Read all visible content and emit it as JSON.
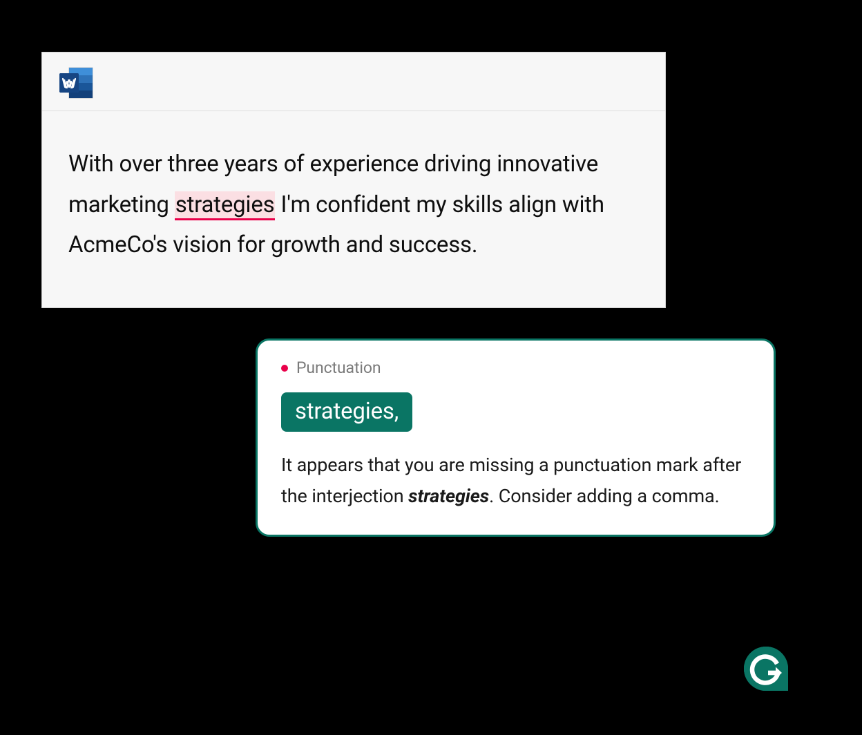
{
  "document": {
    "text_before": "With over three years of experience driving innovative marketing ",
    "highlighted": "strategies",
    "text_after": " I'm confident my skills align with AcmeCo's vision for growth and success."
  },
  "suggestion": {
    "category": "Punctuation",
    "correction": "strategies,",
    "explanation_before": "It appears that you are missing a punctuation mark after the interjection ",
    "explanation_word": "strategies",
    "explanation_after": ". Consider adding a comma."
  },
  "icons": {
    "app": "word-icon",
    "assistant": "grammarly-icon"
  },
  "colors": {
    "teal": "#0a7564",
    "error": "#e9004a",
    "highlight": "#fbdfe3"
  }
}
